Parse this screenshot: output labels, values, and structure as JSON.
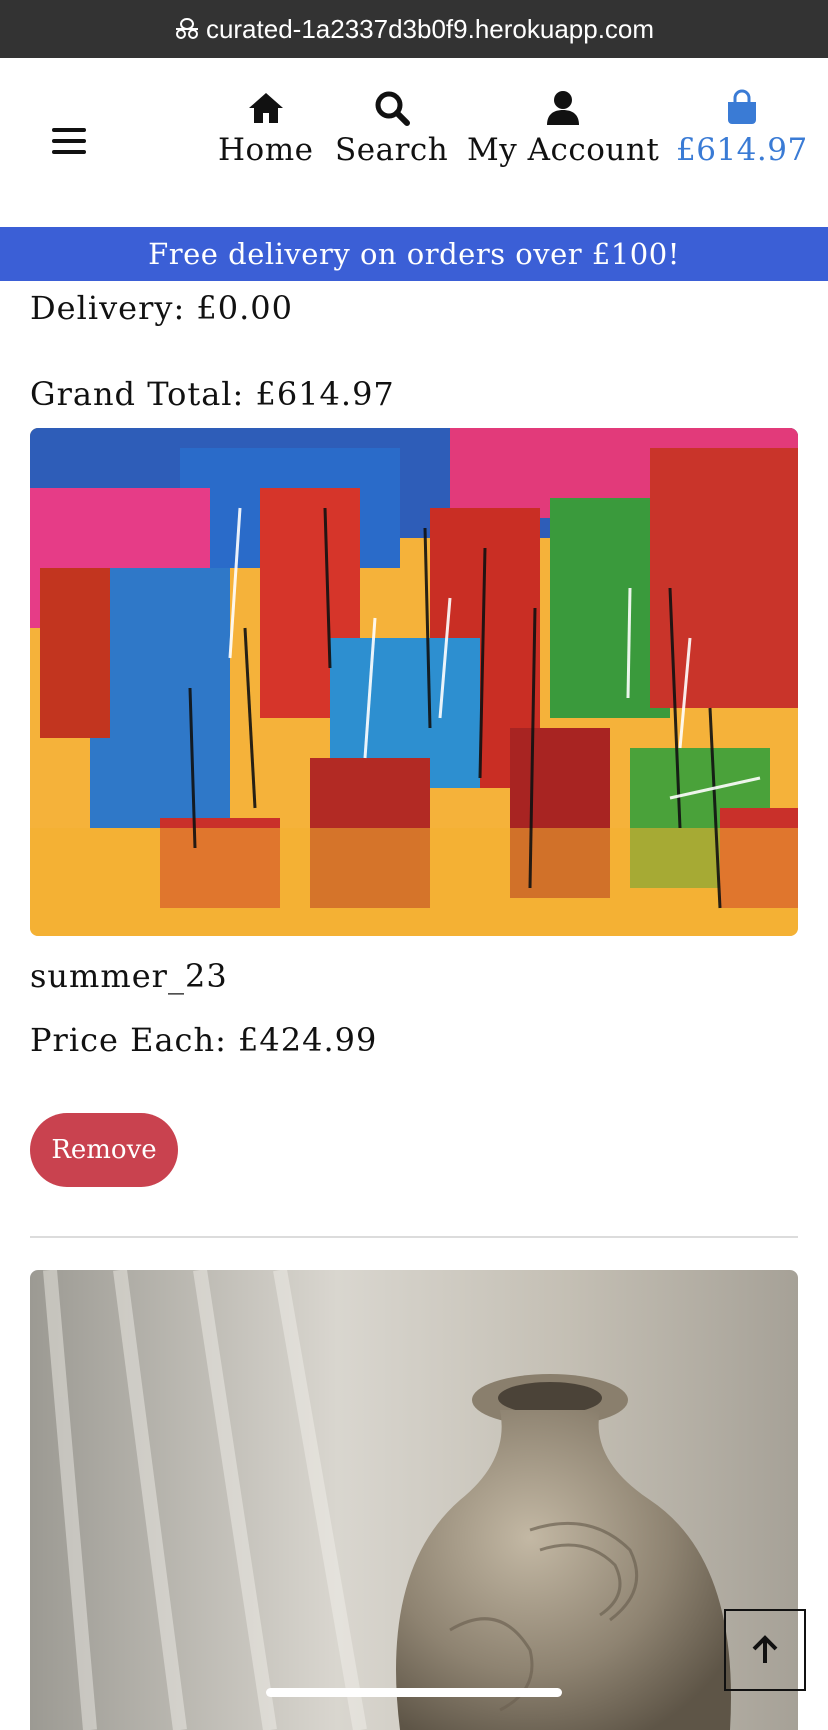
{
  "browser": {
    "url": "curated-1a2337d3b0f9.herokuapp.com"
  },
  "nav": {
    "home_label": "Home",
    "search_label": "Search",
    "account_label": "My Account",
    "bag_total": "£614.97",
    "icons": [
      "menu-icon",
      "home-icon",
      "search-icon",
      "user-icon",
      "shopping-bag-icon"
    ]
  },
  "banner": {
    "text": "Free delivery on orders over £100!"
  },
  "summary": {
    "delivery_text": "Delivery: £0.00",
    "grand_total_text": "Grand Total: £614.97"
  },
  "items": [
    {
      "name": "summer_23",
      "price_text": "Price Each: £424.99",
      "remove_label": "Remove"
    }
  ],
  "colors": {
    "banner": "#3b5fd6",
    "bag_accent": "#3a7bd5",
    "remove_button": "#c9424f"
  }
}
